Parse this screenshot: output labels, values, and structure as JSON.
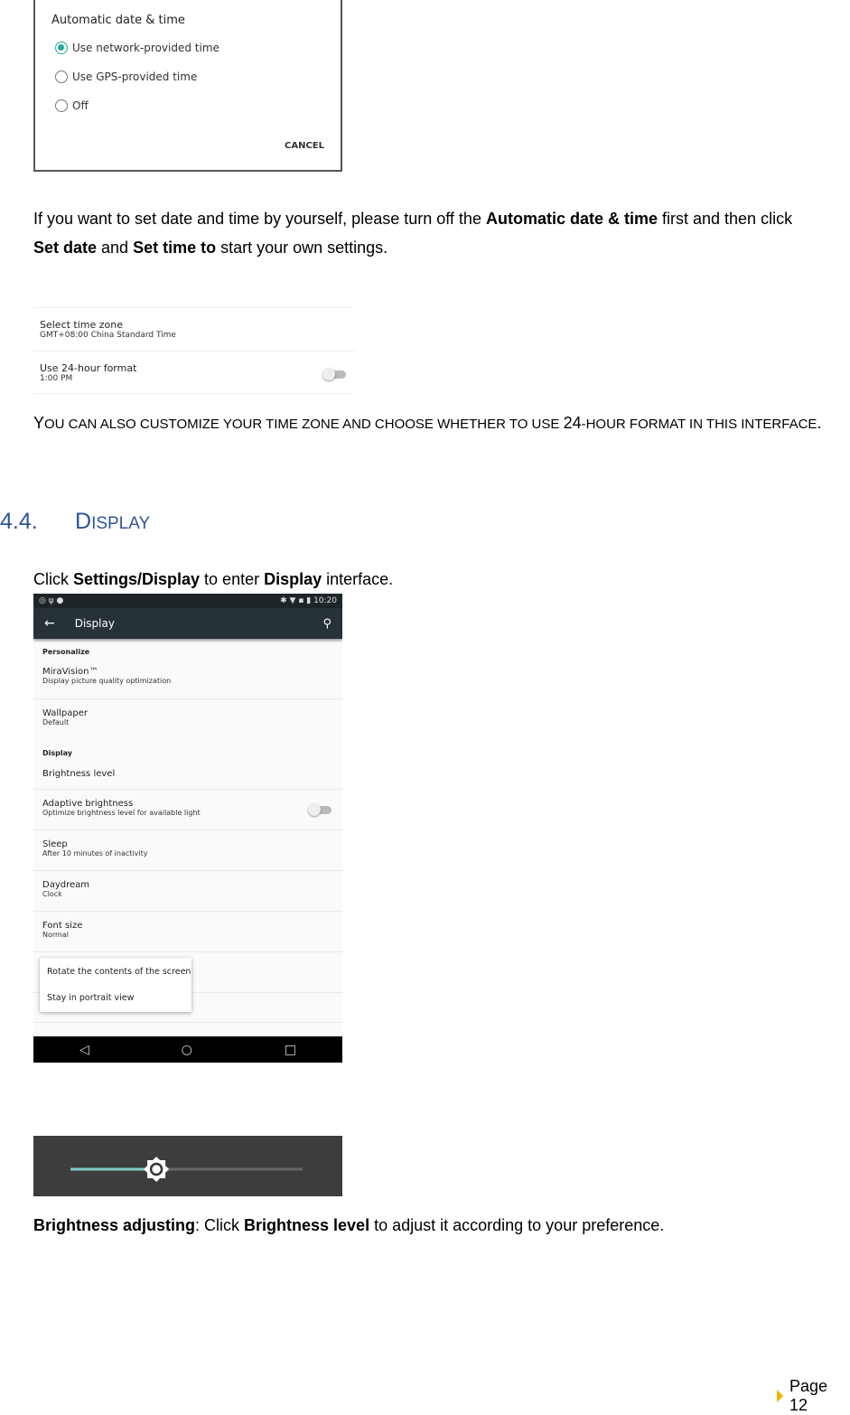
{
  "dialog": {
    "title": "Automatic date & time",
    "options": [
      {
        "label": "Use network-provided time",
        "selected": true
      },
      {
        "label": "Use GPS-provided time",
        "selected": false
      },
      {
        "label": "Off",
        "selected": false
      }
    ],
    "cancel": "CANCEL",
    "accent": "#26a69a"
  },
  "para1": {
    "t1": "If you want to set date and time by yourself, please turn off the ",
    "b1": "Automatic date & time",
    "t2": " first and then click",
    "b2": "Set date",
    "t3": " and ",
    "b3": "Set time to",
    "t4": " start your own settings."
  },
  "timezone": {
    "r1_title": "Select time zone",
    "r1_sub": "GMT+08:00 China Standard Time",
    "r2_title": "Use 24-hour format",
    "r2_sub": "1:00 PM",
    "toggle_on": false
  },
  "para2": {
    "y": "Y",
    "t1": "OU CAN ALSO CUSTOMIZE YOUR TIME ZONE AND CHOOSE WHETHER TO USE ",
    "n": "24",
    "t2": "-HOUR FORMAT IN THIS INTERFACE",
    "end": "."
  },
  "section": {
    "number": "4.4.",
    "title_d": "D",
    "title_rest": "ISPLAY",
    "color": "#2e5597"
  },
  "para3": {
    "t1": "Click ",
    "b1": "Settings/Display",
    "t2": " to enter ",
    "b2": "Display",
    "t3": " interface."
  },
  "phone": {
    "time": "10:20",
    "title": "Display",
    "sections": {
      "personalize": "Personalize",
      "display": "Display"
    },
    "items": [
      {
        "title": "MiraVision™",
        "sub": "Display picture quality optimization"
      },
      {
        "title": "Wallpaper",
        "sub": "Default"
      },
      {
        "title": "Brightness level"
      },
      {
        "title": "Adaptive brightness",
        "sub": "Optimize brightness level for available light"
      },
      {
        "title": "Sleep",
        "sub": "After 10 minutes of inactivity"
      },
      {
        "title": "Daydream",
        "sub": "Clock"
      },
      {
        "title": "Font size",
        "sub": "Normal"
      }
    ],
    "popup": [
      "Rotate the contents of the screen",
      "Stay in portrait view"
    ]
  },
  "brightness": {
    "level_percent": 37,
    "accent": "#80cbc4"
  },
  "para4": {
    "b1": "Brightness adjusting",
    "t1": ": Click ",
    "b2": "Brightness level",
    "t2": " to adjust it according to your preference."
  },
  "footer": {
    "page": "Page 12",
    "marker_color": "#f0b400"
  }
}
